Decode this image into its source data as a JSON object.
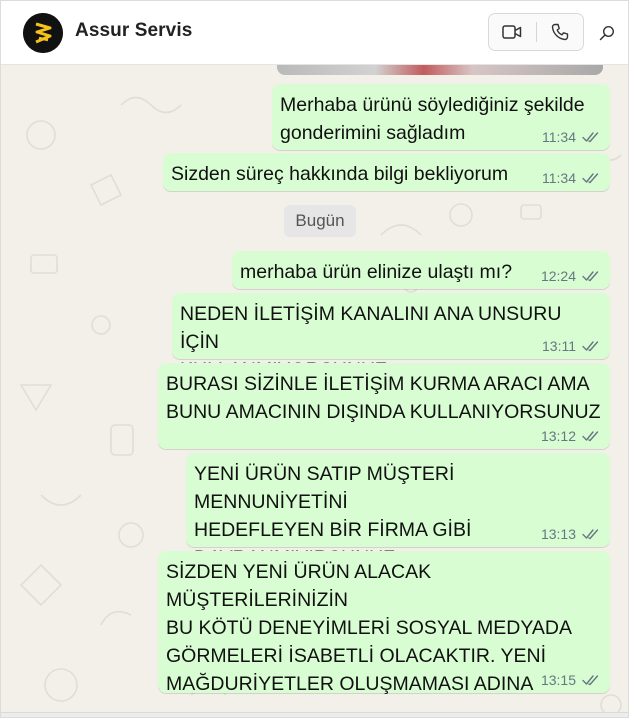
{
  "header": {
    "contact_name": "Assur Servis"
  },
  "chat": {
    "date_chip": "Bugün",
    "messages": [
      {
        "text": "Merhaba ürünü söylediğiniz şekilde\ngonderimini sağladım",
        "time": "11:34"
      },
      {
        "text": "Sizden süreç hakkında bilgi bekliyorum",
        "time": "11:34"
      },
      {
        "text": "merhaba ürün elinize ulaştı mı?",
        "time": "12:24"
      },
      {
        "text": "NEDEN İLETİŞİM KANALINI ANA UNSURU İÇİN\nKULLANMIYORSUNUZ",
        "time": "13:11"
      },
      {
        "text": "BURASI SİZİNLE İLETİŞİM KURMA ARACI AMA\nBUNU AMACININ DIŞINDA KULLANIYORSUNUZ",
        "time": "13:12"
      },
      {
        "text": "YENİ ÜRÜN SATIP MÜŞTERİ MENNUNİYETİNİ\nHEDEFLEYEN BİR FİRMA GİBİ\nDAVRANMIYIRSUNUZ",
        "time": "13:13"
      },
      {
        "text": "SİZDEN YENİ ÜRÜN ALACAK MÜŞTERİLERİNİZİN\nBU KÖTÜ DENEYİMLERİ SOSYAL MEDYADA\nGÖRMELERİ İSABETLİ OLACAKTIR. YENİ\nMAĞDURİYETLER OLUŞMAMASI ADINA",
        "time": "13:15"
      }
    ]
  },
  "colors": {
    "outgoing_bubble": "#d9fdd3",
    "chat_background": "#f3efe9",
    "avatar_logo": "#f6c21a",
    "read_tick": "#667781"
  },
  "icons": [
    "video-call-icon",
    "voice-call-icon",
    "search-icon",
    "double-check-icon"
  ]
}
